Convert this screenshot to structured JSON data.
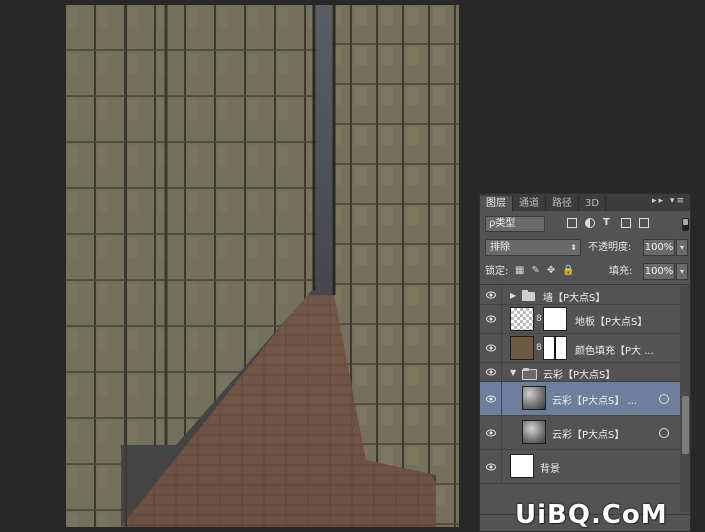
{
  "layers_panel": {
    "tabs": [
      "图层",
      "通道",
      "路径",
      "3D"
    ],
    "tab_controls": "▸▸ ▾≡",
    "filter_type": "ρ类型",
    "blend_mode": "排除",
    "opacity_label": "不透明度:",
    "opacity_value": "100%",
    "lock_label": "锁定:",
    "fill_label": "填充:",
    "fill_value": "100%",
    "layers": [
      {
        "name": "墙【P大点S】",
        "kind": "group",
        "expanded": false
      },
      {
        "name": "地板【P大点S】",
        "kind": "layer-with-mask"
      },
      {
        "name": "颜色填充【P大 ...",
        "kind": "fill-with-mask",
        "fill_color": "#6e5a43"
      },
      {
        "name": "云彩【P大点S】",
        "kind": "group",
        "expanded": true
      },
      {
        "name": "云彩【P大点S】 ...",
        "kind": "smart-object",
        "selected": true
      },
      {
        "name": "云彩【P大点S】",
        "kind": "smart-object"
      },
      {
        "name": "背景",
        "kind": "background"
      }
    ]
  },
  "watermark": "UiBQ.CoM"
}
